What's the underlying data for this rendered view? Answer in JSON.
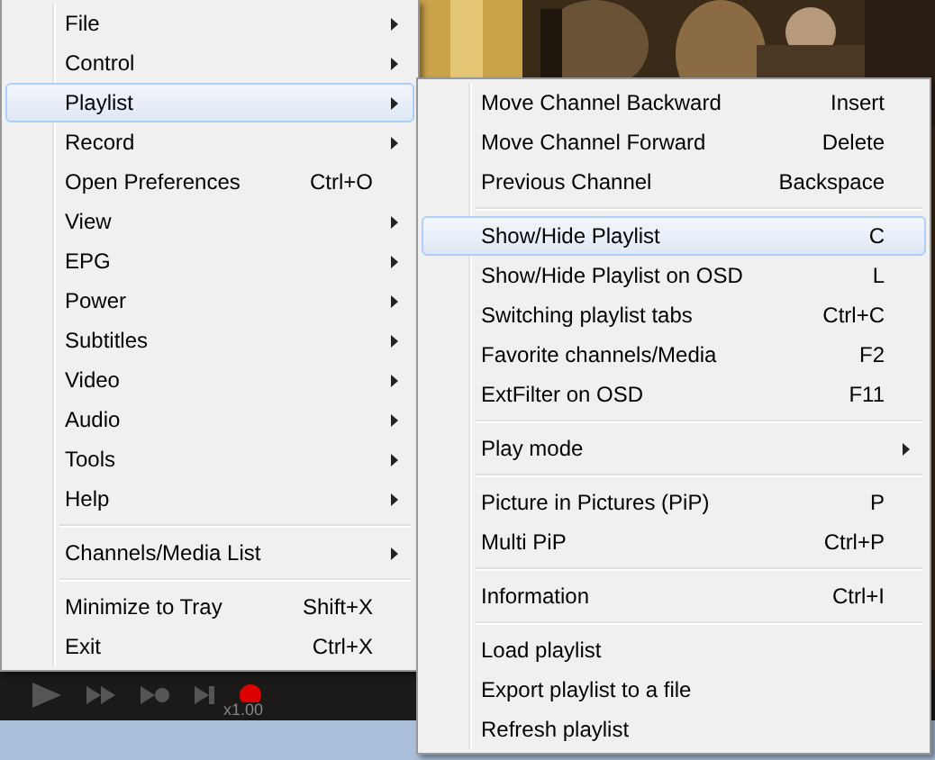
{
  "player": {
    "speed": "x1.00"
  },
  "main_menu": {
    "items": [
      {
        "kind": "item",
        "label": "File",
        "submenu": true,
        "selected": false
      },
      {
        "kind": "item",
        "label": "Control",
        "submenu": true,
        "selected": false
      },
      {
        "kind": "item",
        "label": "Playlist",
        "submenu": true,
        "selected": true
      },
      {
        "kind": "item",
        "label": "Record",
        "submenu": true,
        "selected": false
      },
      {
        "kind": "item",
        "label": "Open Preferences",
        "shortcut": "Ctrl+O",
        "submenu": false,
        "selected": false
      },
      {
        "kind": "item",
        "label": "View",
        "submenu": true,
        "selected": false
      },
      {
        "kind": "item",
        "label": "EPG",
        "submenu": true,
        "selected": false
      },
      {
        "kind": "item",
        "label": "Power",
        "submenu": true,
        "selected": false
      },
      {
        "kind": "item",
        "label": "Subtitles",
        "submenu": true,
        "selected": false
      },
      {
        "kind": "item",
        "label": "Video",
        "submenu": true,
        "selected": false
      },
      {
        "kind": "item",
        "label": "Audio",
        "submenu": true,
        "selected": false
      },
      {
        "kind": "item",
        "label": "Tools",
        "submenu": true,
        "selected": false
      },
      {
        "kind": "item",
        "label": "Help",
        "submenu": true,
        "selected": false
      },
      {
        "kind": "separator"
      },
      {
        "kind": "item",
        "label": "Channels/Media List",
        "submenu": true,
        "selected": false
      },
      {
        "kind": "separator"
      },
      {
        "kind": "item",
        "label": "Minimize to Tray",
        "shortcut": "Shift+X",
        "submenu": false,
        "selected": false
      },
      {
        "kind": "item",
        "label": "Exit",
        "shortcut": "Ctrl+X",
        "submenu": false,
        "selected": false
      }
    ]
  },
  "playlist_menu": {
    "items": [
      {
        "kind": "item",
        "label": "Move Channel Backward",
        "shortcut": "Insert",
        "submenu": false,
        "selected": false
      },
      {
        "kind": "item",
        "label": "Move Channel Forward",
        "shortcut": "Delete",
        "submenu": false,
        "selected": false
      },
      {
        "kind": "item",
        "label": "Previous Channel",
        "shortcut": "Backspace",
        "submenu": false,
        "selected": false
      },
      {
        "kind": "separator"
      },
      {
        "kind": "item",
        "label": "Show/Hide Playlist",
        "shortcut": "C",
        "submenu": false,
        "selected": true
      },
      {
        "kind": "item",
        "label": "Show/Hide Playlist on OSD",
        "shortcut": "L",
        "submenu": false,
        "selected": false
      },
      {
        "kind": "item",
        "label": "Switching playlist tabs",
        "shortcut": "Ctrl+C",
        "submenu": false,
        "selected": false
      },
      {
        "kind": "item",
        "label": "Favorite channels/Media",
        "shortcut": "F2",
        "submenu": false,
        "selected": false
      },
      {
        "kind": "item",
        "label": "ExtFilter on OSD",
        "shortcut": "F11",
        "submenu": false,
        "selected": false
      },
      {
        "kind": "separator"
      },
      {
        "kind": "item",
        "label": "Play mode",
        "submenu": true,
        "selected": false
      },
      {
        "kind": "separator"
      },
      {
        "kind": "item",
        "label": "Picture in Pictures (PiP)",
        "shortcut": "P",
        "submenu": false,
        "selected": false
      },
      {
        "kind": "item",
        "label": "Multi PiP",
        "shortcut": "Ctrl+P",
        "submenu": false,
        "selected": false
      },
      {
        "kind": "separator"
      },
      {
        "kind": "item",
        "label": "Information",
        "shortcut": "Ctrl+I",
        "submenu": false,
        "selected": false
      },
      {
        "kind": "separator"
      },
      {
        "kind": "item",
        "label": "Load playlist",
        "submenu": false,
        "selected": false
      },
      {
        "kind": "item",
        "label": "Export playlist to a file",
        "submenu": false,
        "selected": false
      },
      {
        "kind": "item",
        "label": "Refresh playlist",
        "submenu": false,
        "selected": false
      }
    ]
  }
}
